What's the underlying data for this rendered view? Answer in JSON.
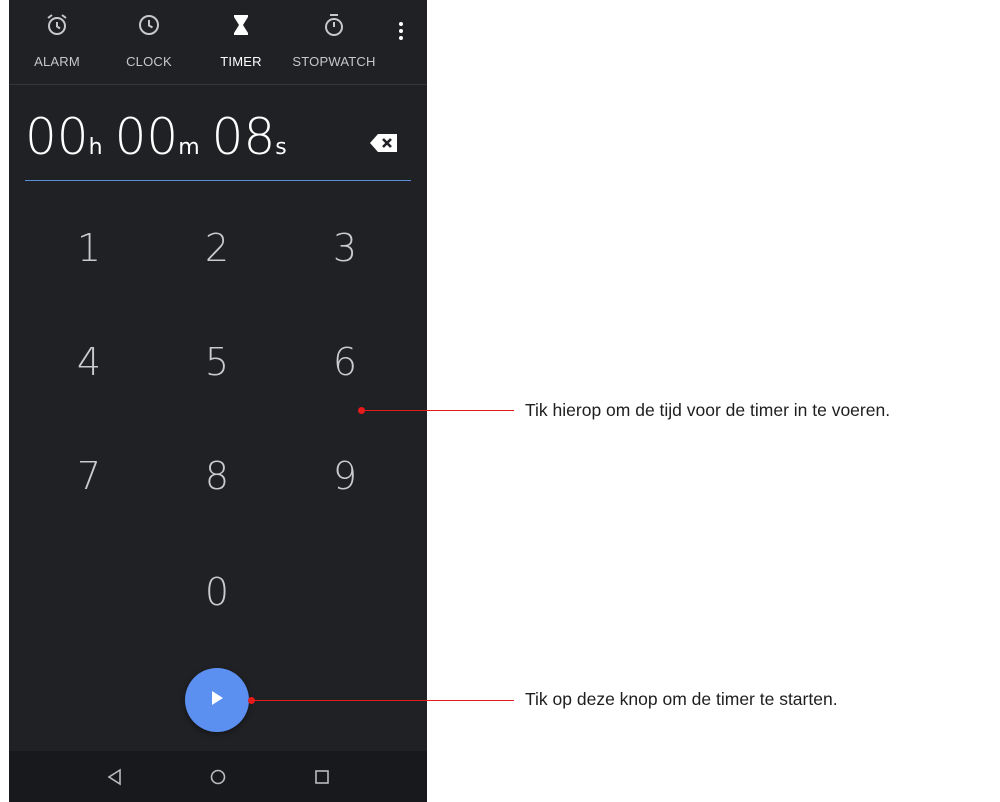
{
  "tabs": [
    {
      "label": "ALARM",
      "icon": "alarm-clock-icon"
    },
    {
      "label": "CLOCK",
      "icon": "clock-icon"
    },
    {
      "label": "TIMER",
      "icon": "hourglass-icon"
    },
    {
      "label": "STOPWATCH",
      "icon": "stopwatch-icon"
    }
  ],
  "active_tab": "TIMER",
  "timer_input": {
    "hours": "00",
    "hours_unit": "h",
    "minutes": "00",
    "minutes_unit": "m",
    "seconds": "08",
    "seconds_unit": "s"
  },
  "keypad": [
    "1",
    "2",
    "3",
    "4",
    "5",
    "6",
    "7",
    "8",
    "9",
    "0"
  ],
  "callouts": {
    "keypad": "Tik hierop om de tijd voor de timer in te voeren.",
    "start": "Tik op deze knop om de timer te starten."
  },
  "colors": {
    "background": "#202125",
    "accent": "#5b8ff0",
    "callout": "#e51a1a"
  }
}
